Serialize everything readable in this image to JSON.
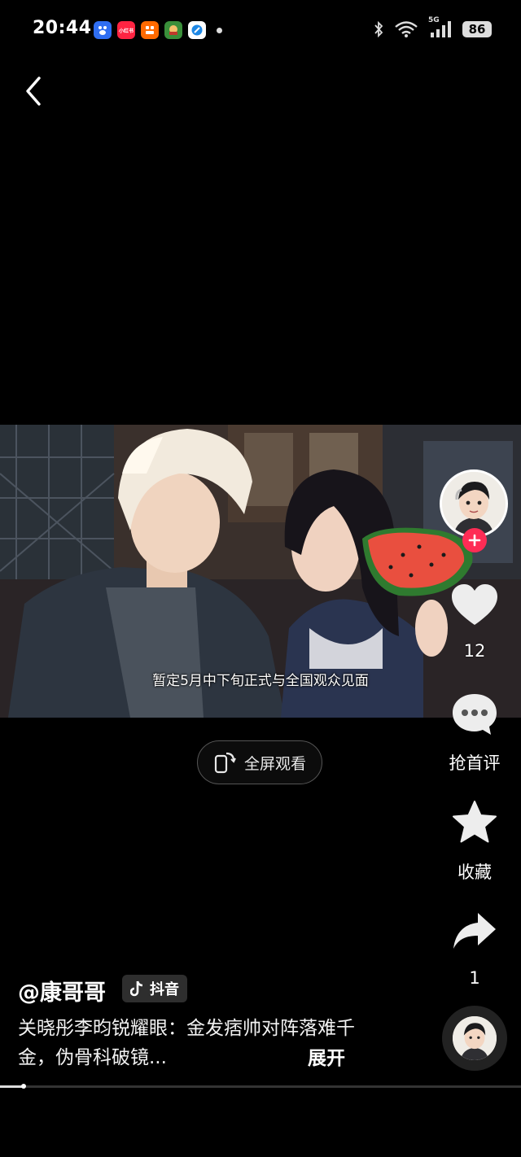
{
  "status_bar": {
    "time": "20:44",
    "apps": [
      {
        "name": "baidu-app-icon",
        "color": "#2f6ef2",
        "label": ""
      },
      {
        "name": "xiaohongshu-app-icon",
        "color": "#ff2442",
        "label": "小红书"
      },
      {
        "name": "orange-app-icon",
        "color": "#ff6a00",
        "label": ""
      },
      {
        "name": "game-app-icon",
        "color": "#3a8f3a",
        "label": ""
      },
      {
        "name": "blue-app-icon",
        "color": "#1e88e5",
        "label": ""
      }
    ],
    "network": "5G",
    "battery": "86"
  },
  "video": {
    "subtitle": "暂定5月中下旬正式与全国观众见面"
  },
  "fullscreen": {
    "label": "全屏观看"
  },
  "side_rail": {
    "like_count": "12",
    "comment_label": "抢首评",
    "favorite_label": "收藏",
    "share_count": "1"
  },
  "post": {
    "author": "@康哥哥",
    "platform_badge": "抖音",
    "caption": "关晓彤李昀锐耀眼：金发痞帅对阵落难千金，伪骨科破镜...",
    "expand_label": "展开"
  },
  "playback": {
    "progress": 0.045
  },
  "colors": {
    "accent": "#fe2c55",
    "background": "#000000"
  }
}
